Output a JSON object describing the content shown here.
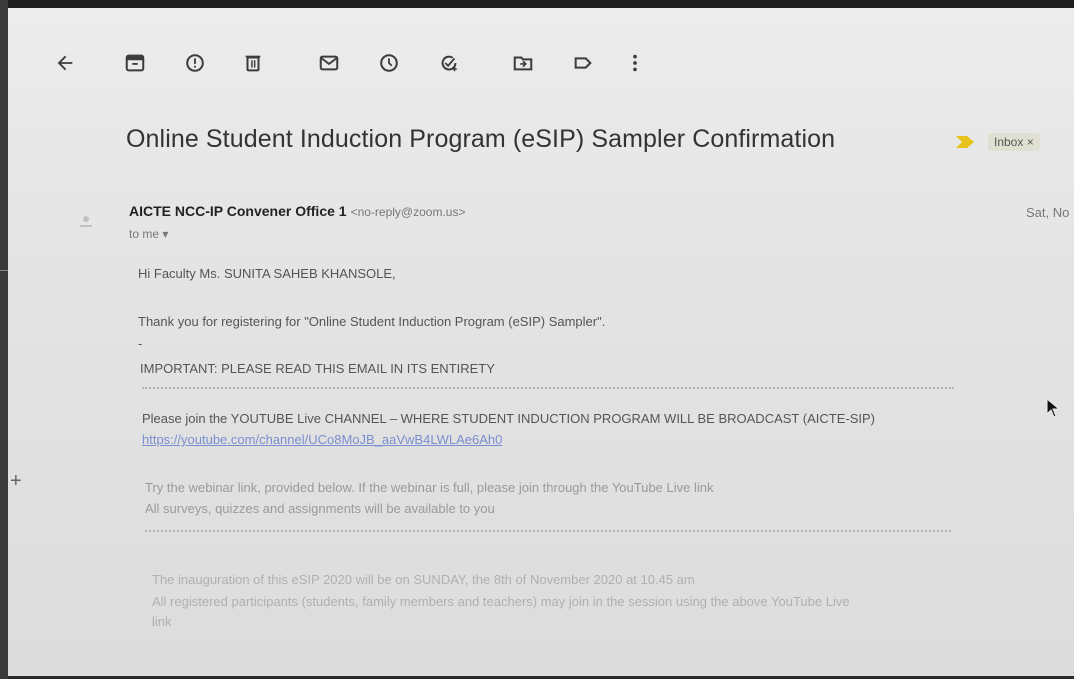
{
  "toolbar": {
    "icons": [
      "back-arrow-icon",
      "archive-icon",
      "report-spam-icon",
      "delete-icon",
      "mark-unread-icon",
      "snooze-icon",
      "add-to-tasks-icon",
      "move-to-icon",
      "labels-icon",
      "more-vert-icon"
    ]
  },
  "email": {
    "subject": "Online Student Induction Program (eSIP) Sampler Confirmation",
    "label": "Inbox ×",
    "sender_name": "AICTE NCC-IP Convener Office 1",
    "sender_email": "<no-reply@zoom.us>",
    "date": "Sat, No",
    "recipient": "to me ▾",
    "greeting": "Hi Faculty Ms. SUNITA SAHEB KHANSOLE,",
    "thanks": "Thank you for registering for \"Online Student Induction Program (eSIP) Sampler\".",
    "dash": "-",
    "important": "IMPORTANT: PLEASE READ THIS EMAIL IN ITS ENTIRETY",
    "join_youtube": "Please join the YOUTUBE Live CHANNEL – WHERE STUDENT INDUCTION PROGRAM WILL BE BROADCAST (AICTE-SIP)",
    "youtube_link": "https://youtube.com/channel/UCo8MoJB_aaVwB4LWLAe6Ah0",
    "webinar_line": "Try the webinar link, provided below. If the webinar is full, please join through the YouTube Live link",
    "surveys_line": "All surveys, quizzes and assignments will be available to you",
    "inauguration_line": "The inauguration of this eSIP 2020 will be on SUNDAY, the 8th of November 2020 at 10.45 am",
    "participants_line": "All registered participants (students, family members and teachers) may join in the session using the above YouTube Live",
    "participants_line_end": "link"
  },
  "colors": {
    "importance_marker": "#e8c21a",
    "link": "#7a8fd0"
  }
}
